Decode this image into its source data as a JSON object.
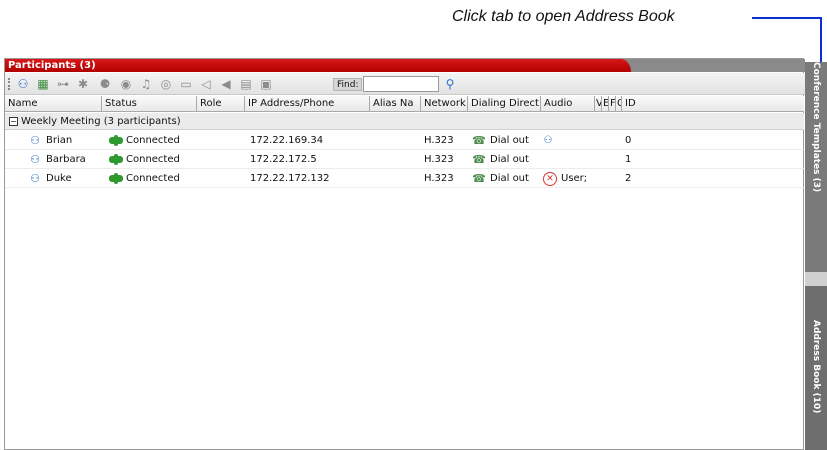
{
  "callout": {
    "text": "Click tab to open Address Book"
  },
  "panel": {
    "title": "Participants (3)"
  },
  "toolbar": {
    "find_label": "Find:",
    "find_value": "",
    "icons": [
      "add-participant-icon",
      "add-from-book-icon",
      "connect-icon",
      "disconnect-icon",
      "delete-icon",
      "mute-icon",
      "audio-icon",
      "video-icon",
      "camera-icon",
      "speaker-icon",
      "volume-icon",
      "layout-icon",
      "record-icon"
    ]
  },
  "columns": [
    "Name",
    "Status",
    "Role",
    "IP Address/Phone",
    "Alias Na",
    "Network",
    "Dialing Direct",
    "Audio",
    "V",
    "E",
    "F",
    "C",
    "ID"
  ],
  "group": {
    "expander": "−",
    "label": "Weekly Meeting (3 participants)"
  },
  "rows": [
    {
      "name": "Brian",
      "status": "Connected",
      "role": "",
      "ip": "172.22.169.34",
      "alias": "",
      "network": "H.323",
      "dialing": "Dial out",
      "audio": "",
      "id": "0"
    },
    {
      "name": "Barbara",
      "status": "Connected",
      "role": "",
      "ip": "172.22.172.5",
      "alias": "",
      "network": "H.323",
      "dialing": "Dial out",
      "audio": "",
      "id": "1"
    },
    {
      "name": "Duke",
      "status": "Connected",
      "role": "",
      "ip": "172.22.172.132",
      "alias": "",
      "network": "H.323",
      "dialing": "Dial out",
      "audio": "User;",
      "id": "2"
    }
  ],
  "side_tabs": {
    "conference_templates": "Conference Templates (3)",
    "address_book": "Address Book (10)"
  },
  "colors": {
    "title_red": "#c80000",
    "callout_arrow": "#0a2fd6",
    "side_tab": "#777777"
  }
}
